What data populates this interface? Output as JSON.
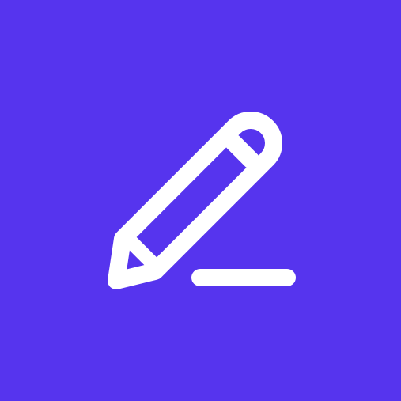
{
  "app": {
    "icon_name": "edit-pencil-icon",
    "background_color": "#5634EE",
    "foreground_color": "#FFFFFF"
  }
}
